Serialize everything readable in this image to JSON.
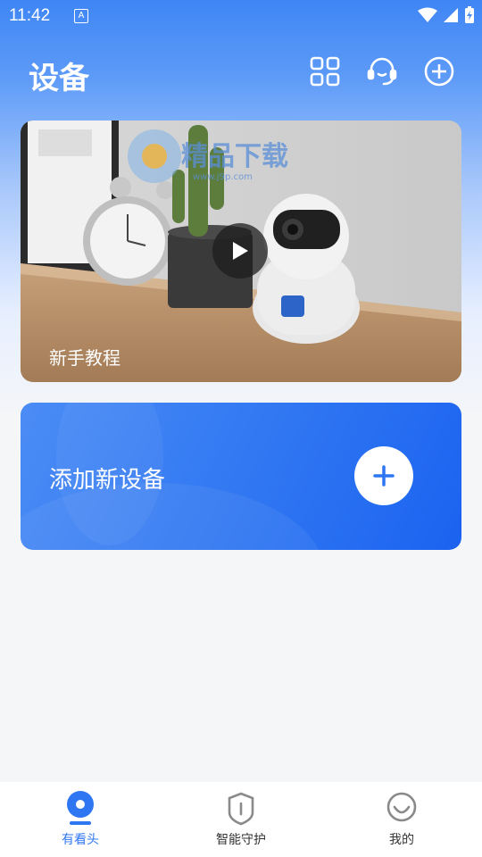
{
  "status_bar": {
    "time": "11:42",
    "app_badge": "A"
  },
  "header": {
    "title": "设备"
  },
  "tutorial": {
    "label": "新手教程",
    "watermark_text": "精品下载",
    "watermark_url": "www.j9p.com"
  },
  "add_device": {
    "label": "添加新设备"
  },
  "bottom_nav": {
    "items": [
      {
        "label": "有看头",
        "icon": "camera-icon",
        "active": true
      },
      {
        "label": "智能守护",
        "icon": "shield-icon",
        "active": false
      },
      {
        "label": "我的",
        "icon": "smile-icon",
        "active": false
      }
    ]
  },
  "colors": {
    "primary": "#2f76f2",
    "text": "#333333",
    "inactive_icon": "#8a8a8a"
  }
}
